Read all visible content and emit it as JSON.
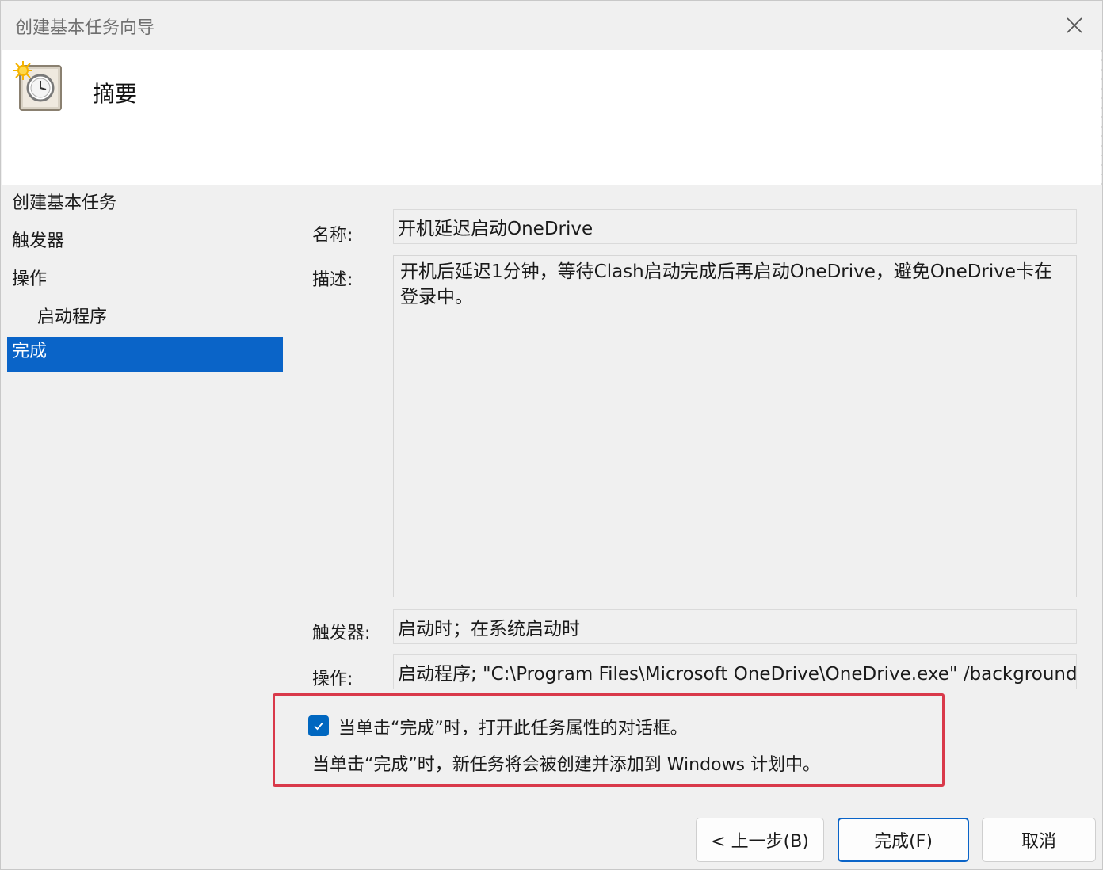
{
  "window": {
    "title": "创建基本任务向导"
  },
  "header": {
    "heading": "摘要",
    "icon": "task-scheduler-clock-icon"
  },
  "steps": [
    {
      "label": "创建基本任务"
    },
    {
      "label": "触发器"
    },
    {
      "label": "操作"
    },
    {
      "label": "启动程序"
    },
    {
      "label": "完成"
    }
  ],
  "summary": {
    "name_label": "名称:",
    "name_value": "开机延迟启动OneDrive",
    "desc_label": "描述:",
    "desc_value": "开机后延迟1分钟，等待Clash启动完成后再启动OneDrive，避免OneDrive卡在登录中。",
    "trigger_label": "触发器:",
    "trigger_value": "启动时；在系统启动时",
    "action_label": "操作:",
    "action_value": "启动程序; \"C:\\Program Files\\Microsoft OneDrive\\OneDrive.exe\" /background"
  },
  "options": {
    "open_properties_label": "当单击“完成”时，打开此任务属性的对话框。",
    "open_properties_checked": true,
    "info": "当单击“完成”时，新任务将会被创建并添加到 Windows 计划中。"
  },
  "buttons": {
    "back": "< 上一步(B)",
    "finish": "完成(F)",
    "cancel": "取消"
  },
  "colors": {
    "accent": "#0a64c8",
    "highlight_border": "#d9394a",
    "checkbox": "#0067c0"
  }
}
